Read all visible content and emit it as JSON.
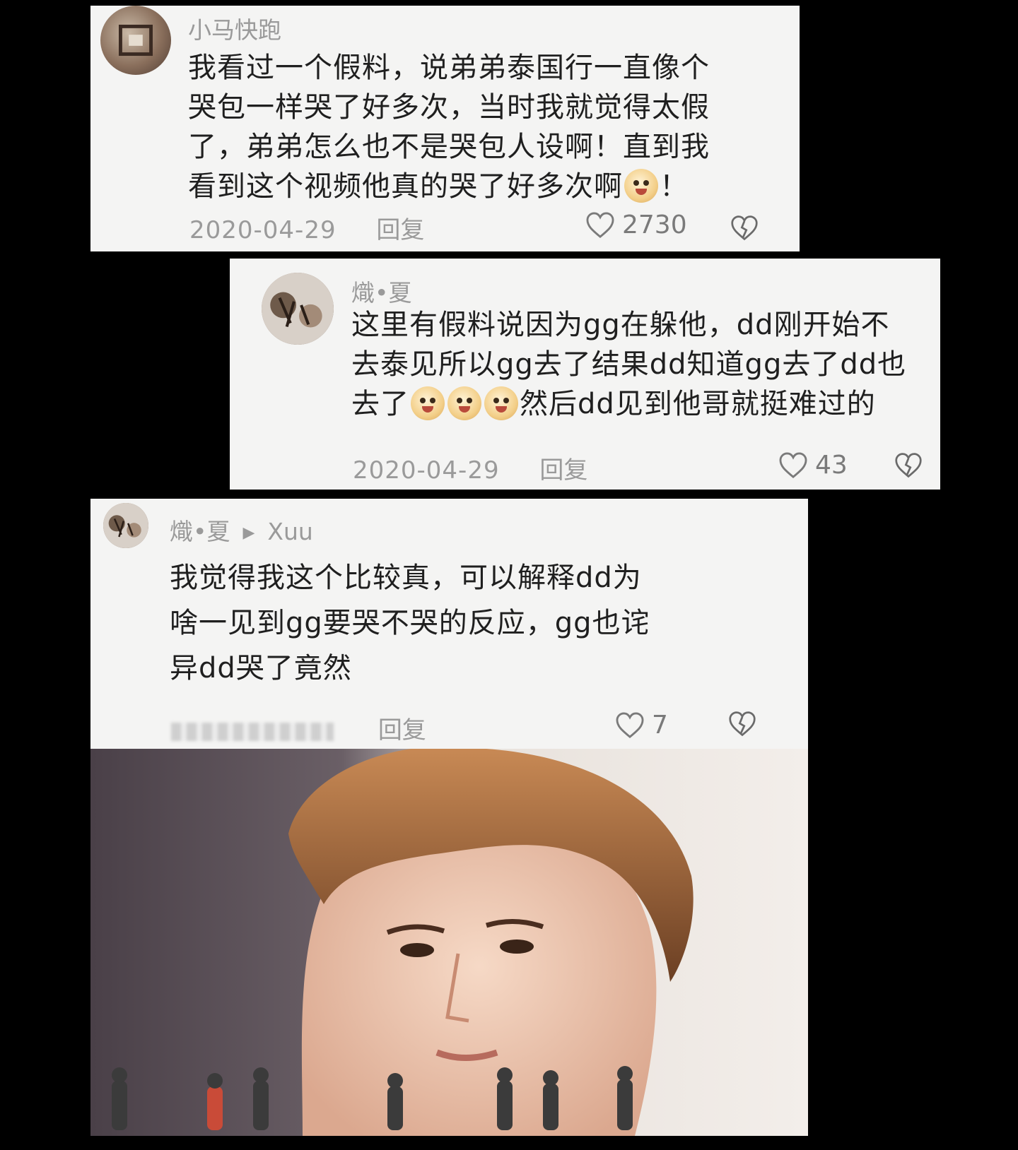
{
  "comments": [
    {
      "username": "小马快跑",
      "lines": [
        "我看过一个假料，说弟弟泰国行一直像个",
        "哭包一样哭了好多次，当时我就觉得太假",
        "了，弟弟怎么也不是哭包人设啊！直到我",
        "看到这个视频他真的哭了好多次啊"
      ],
      "line_tail": "！",
      "emoji": "pleading-emoji",
      "date": "2020-04-29",
      "reply_label": "回复",
      "likes": "2730"
    },
    {
      "username": "熾•夏",
      "lines": [
        "这里有假料说因为gg在躲他，dd刚开始不",
        "去泰见所以gg去了结果dd知道gg去了dd也"
      ],
      "line3_prefix": "去了",
      "line3_suffix": "然后dd见到他哥就挺难过的",
      "emoji": "laughing-emoji",
      "date": "2020-04-29",
      "reply_label": "回复",
      "likes": "43"
    },
    {
      "username": "熾•夏",
      "reply_to": "Xuu",
      "lines": [
        "我觉得我这个比较真，可以解释dd为",
        "啥一见到gg要哭不哭的反应，gg也诧",
        "异dd哭了竟然"
      ],
      "reply_label": "回复",
      "likes": "7"
    }
  ],
  "icons": {
    "like": "heart-outline-icon",
    "dislike": "broken-heart-icon",
    "reply_arrow": "triangle-right-icon"
  },
  "colors": {
    "card_bg": "#f4f4f3",
    "background": "#000000",
    "meta_text": "#9a9a9a"
  }
}
